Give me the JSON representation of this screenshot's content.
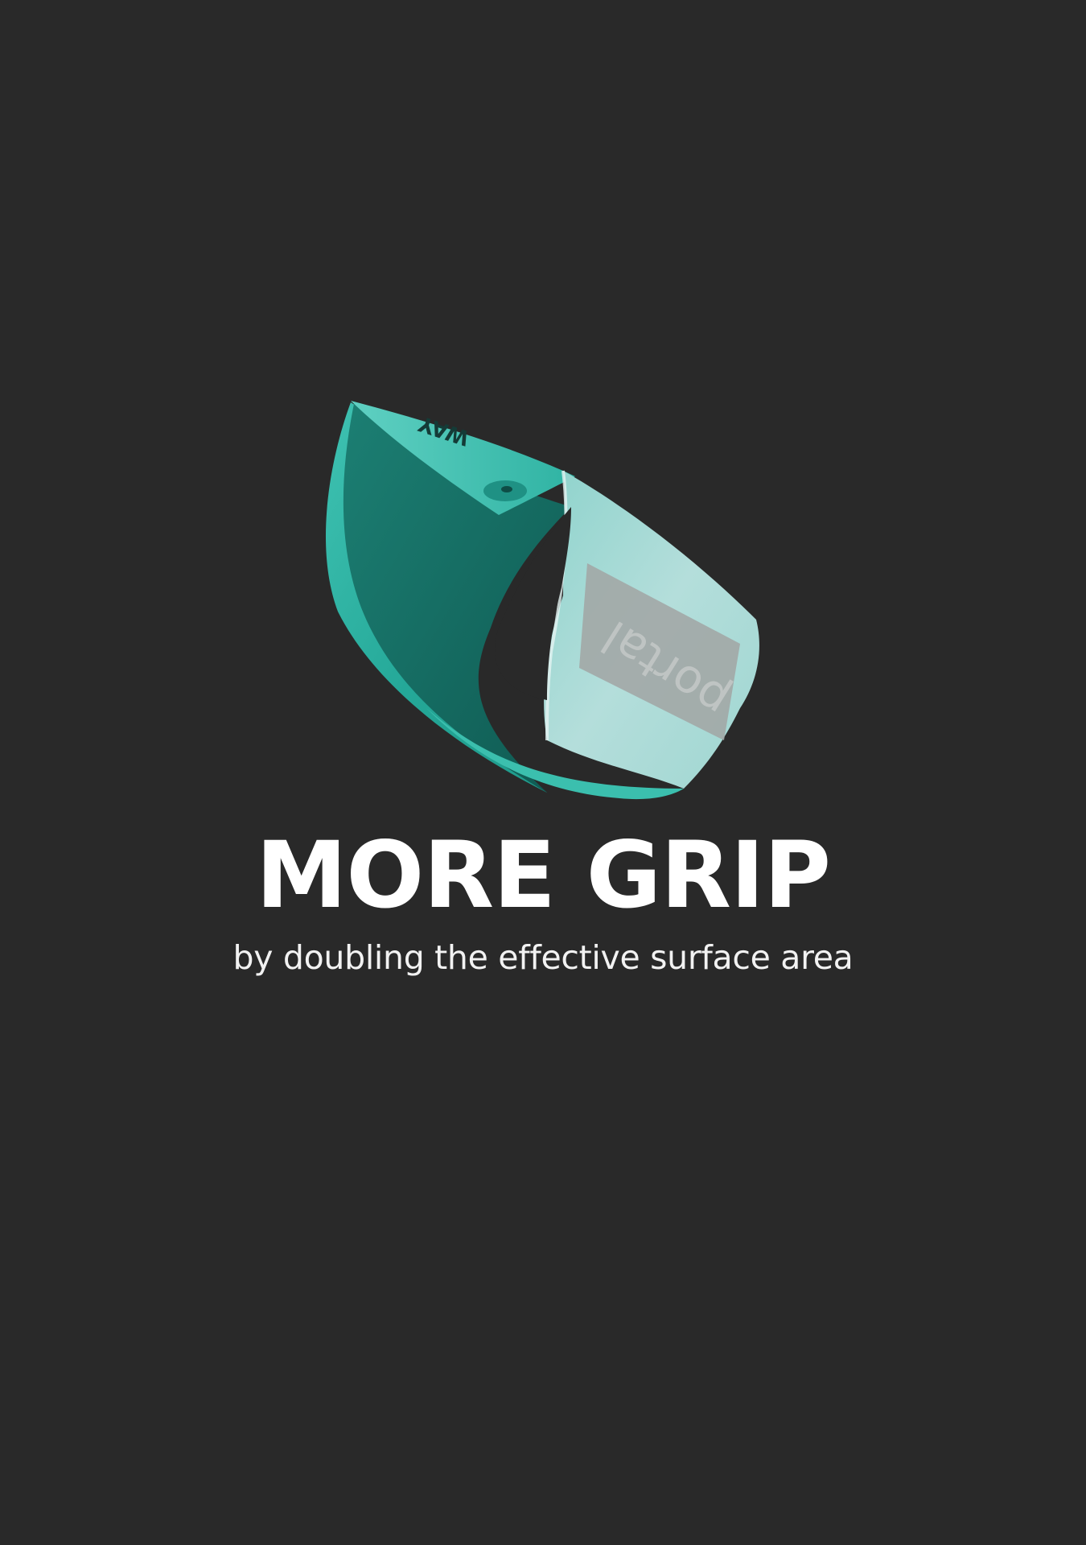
{
  "colors": {
    "background": "#292929",
    "product_teal": "#2bb3a2",
    "product_teal_light": "#a9d8d6",
    "stripe_grey": "#9e9e9e",
    "text": "#ffffff"
  },
  "product": {
    "brand_mark_top": "WAY",
    "brand_mark_side": "portal"
  },
  "headline": "MORE GRIP",
  "subline": "by doubling the effective surface area"
}
